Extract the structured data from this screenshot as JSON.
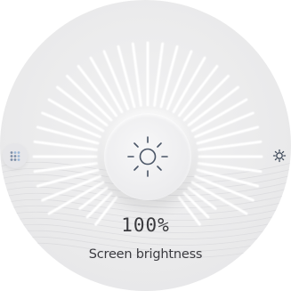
{
  "brightness": {
    "percent_text": "100%",
    "label": "Screen brightness",
    "level": 1.0
  },
  "controls": {
    "left_icon": "dots-grid-icon",
    "right_icon": "sun-small-icon",
    "center_icon": "sun-icon"
  },
  "colors": {
    "face": "#ebebec",
    "rays": "#ffffff",
    "text": "#3a3a3e",
    "icon": "#4a5566",
    "accent_dots": "#9bb7d6"
  }
}
